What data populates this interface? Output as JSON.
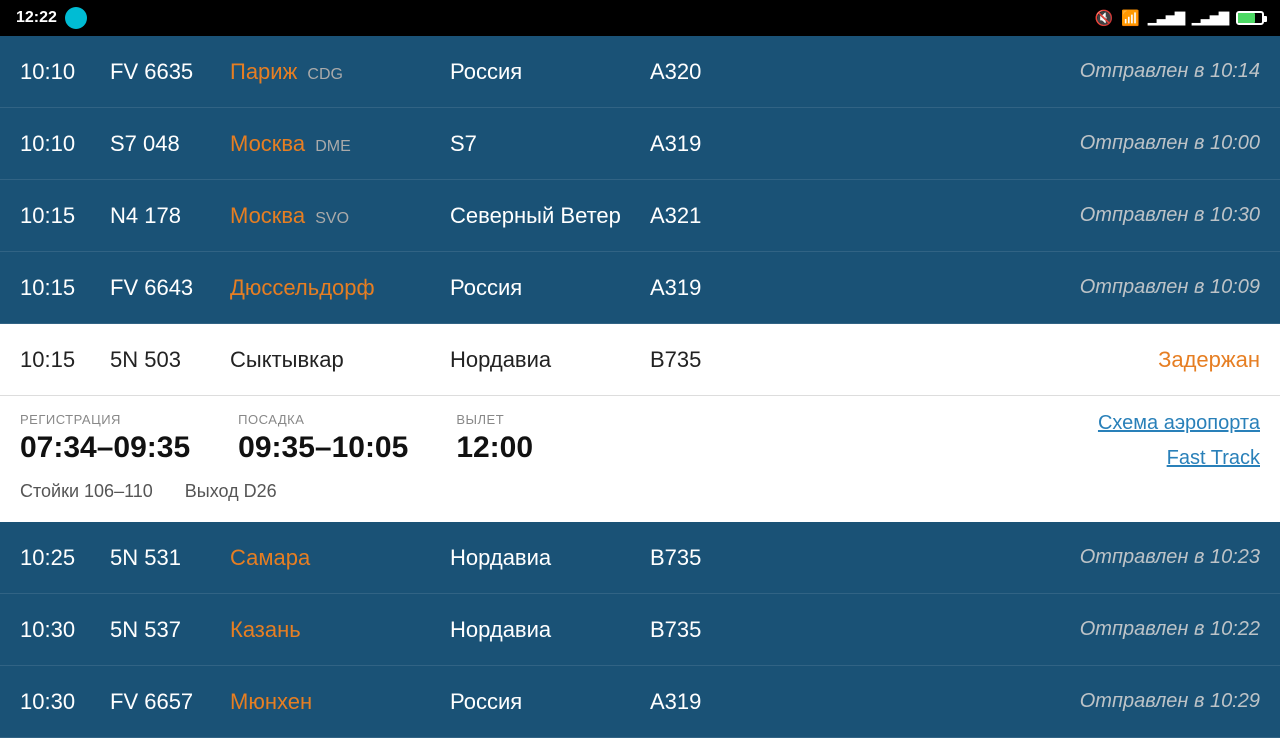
{
  "statusBar": {
    "time": "12:22",
    "icons": [
      "mute",
      "wifi",
      "signal1",
      "signal2",
      "battery"
    ]
  },
  "flights": [
    {
      "time": "10:10",
      "flight": "FV 6635",
      "destination": "Париж",
      "destCode": "CDG",
      "airline": "Россия",
      "aircraft": "A320",
      "status": "Отправлен в 10:14",
      "destinationHighlight": true,
      "expanded": false
    },
    {
      "time": "10:10",
      "flight": "S7 048",
      "destination": "Москва",
      "destCode": "DME",
      "airline": "S7",
      "aircraft": "A319",
      "status": "Отправлен в 10:00",
      "destinationHighlight": true,
      "expanded": false
    },
    {
      "time": "10:15",
      "flight": "N4 178",
      "destination": "Москва",
      "destCode": "SVO",
      "airline": "Северный Ветер",
      "aircraft": "A321",
      "status": "Отправлен в 10:30",
      "destinationHighlight": true,
      "expanded": false
    },
    {
      "time": "10:15",
      "flight": "FV 6643",
      "destination": "Дюссельдорф",
      "destCode": "",
      "airline": "Россия",
      "aircraft": "A319",
      "status": "Отправлен в 10:09",
      "destinationHighlight": true,
      "expanded": false
    }
  ],
  "expandedFlight": {
    "time": "10:15",
    "flight": "5N 503",
    "destination": "Сыктывкар",
    "destCode": "",
    "airline": "Нордавиа",
    "aircraft": "B735",
    "status": "Задержан",
    "registration": {
      "label": "РЕГИСТРАЦИЯ",
      "value": "07:34–09:35"
    },
    "boarding": {
      "label": "ПОСАДКА",
      "value": "09:35–10:05"
    },
    "departure": {
      "label": "ВЫЛЕТ",
      "value": "12:00"
    },
    "counters": "Стойки 106–110",
    "gate": "Выход D26",
    "schemaLink": "Схема аэропорта",
    "fastTrackLink": "Fast Track"
  },
  "flightsBelow": [
    {
      "time": "10:25",
      "flight": "5N 531",
      "destination": "Самара",
      "destCode": "",
      "airline": "Нордавиа",
      "aircraft": "B735",
      "status": "Отправлен в 10:23",
      "destinationHighlight": true
    },
    {
      "time": "10:30",
      "flight": "5N 537",
      "destination": "Казань",
      "destCode": "",
      "airline": "Нордавиа",
      "aircraft": "B735",
      "status": "Отправлен в 10:22",
      "destinationHighlight": true
    },
    {
      "time": "10:30",
      "flight": "FV 6657",
      "destination": "Мюнхен",
      "destCode": "",
      "airline": "Россия",
      "aircraft": "A319",
      "status": "Отправлен в 10:29",
      "destinationHighlight": true
    }
  ]
}
